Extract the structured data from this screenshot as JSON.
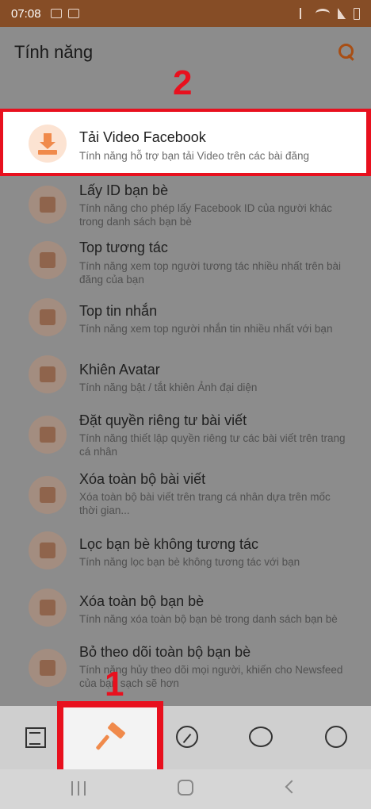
{
  "status_bar": {
    "time": "07:08"
  },
  "header": {
    "title": "Tính năng"
  },
  "markers": {
    "step1": "1",
    "step2": "2"
  },
  "featured": {
    "name": "Tải Video Facebook",
    "desc": "Tính năng hỗ trợ bạn tải Video trên các bài đăng"
  },
  "features": [
    {
      "name": "Lấy ID bạn bè",
      "desc": "Tính năng cho phép lấy Facebook ID của người khác trong danh sách bạn bè"
    },
    {
      "name": "Top tương tác",
      "desc": "Tính năng xem top người tương tác nhiều nhất trên bài đăng của bạn"
    },
    {
      "name": "Top tin nhắn",
      "desc": "Tính năng xem top người nhắn tin nhiều nhất với bạn"
    },
    {
      "name": "Khiên Avatar",
      "desc": "Tính năng bật / tắt khiên Ảnh đại diện"
    },
    {
      "name": "Đặt quyền riêng tư bài viết",
      "desc": "Tính năng thiết lập quyền riêng tư các bài viết trên trang cá nhân"
    },
    {
      "name": "Xóa toàn bộ bài viết",
      "desc": "Xóa toàn bộ bài viết trên trang cá nhân dựa trên mốc thời gian..."
    },
    {
      "name": "Lọc bạn bè không tương tác",
      "desc": "Tính năng lọc bạn bè không tương tác với bạn"
    },
    {
      "name": "Xóa toàn bộ bạn bè",
      "desc": "Tính năng xóa toàn bộ bạn bè trong danh sách bạn bè"
    },
    {
      "name": "Bỏ theo dõi toàn bộ bạn bè",
      "desc": "Tính năng hủy theo dõi mọi người, khiến cho Newsfeed của bạn sạch sẽ hơn"
    }
  ],
  "colors": {
    "accent": "#f08a4b",
    "highlight": "#e8101e",
    "status_bar": "#864d26"
  }
}
